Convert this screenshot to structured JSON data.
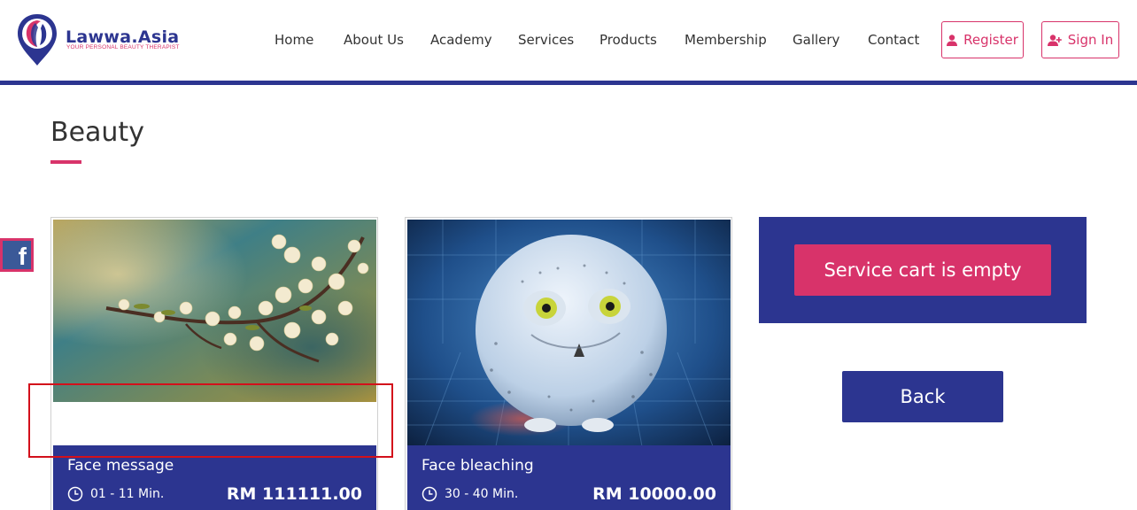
{
  "brand": {
    "name": "Lawwa.Asia",
    "tagline": "YOUR PERSONAL BEAUTY THERAPIST",
    "colors": {
      "primary": "#2c3590",
      "accent": "#d8336a"
    }
  },
  "nav": {
    "items": [
      "Home",
      "About Us",
      "Academy",
      "Services",
      "Products",
      "Membership",
      "Gallery",
      "Contact"
    ]
  },
  "auth": {
    "register_label": "Register",
    "signin_label": "Sign In"
  },
  "page": {
    "title": "Beauty"
  },
  "social": {
    "facebook_icon": "facebook-icon"
  },
  "services": [
    {
      "name": "Face message",
      "duration": "01 - 11 Min.",
      "price": "RM 111111.00",
      "image": "cherry-blossom-branch"
    },
    {
      "name": "Face bleaching",
      "duration": "30 - 40 Min.",
      "price": "RM 10000.00",
      "image": "snowy-owl-ball"
    }
  ],
  "cart": {
    "empty_label": "Service cart is empty",
    "back_label": "Back"
  }
}
